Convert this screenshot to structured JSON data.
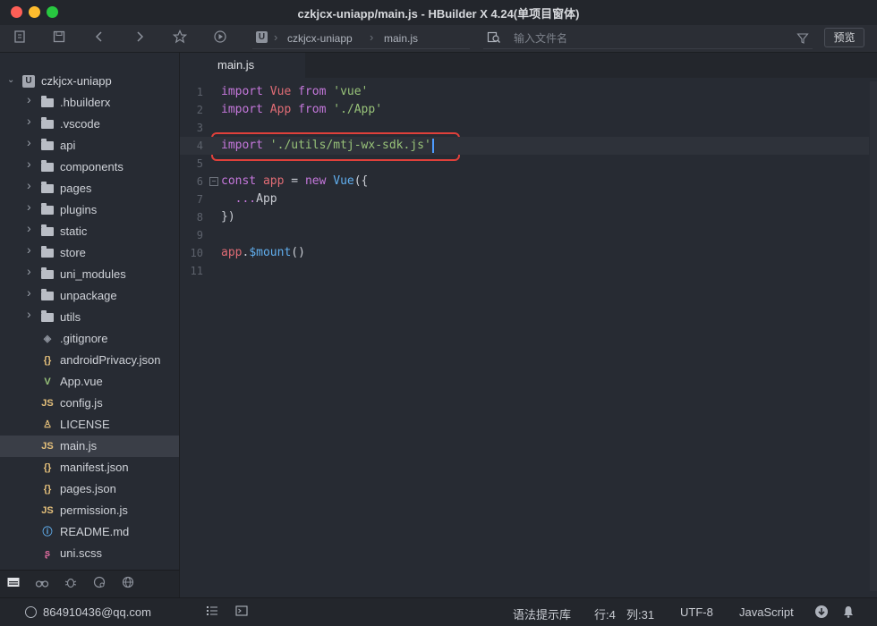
{
  "window": {
    "title": "czkjcx-uniapp/main.js - HBuilder X 4.24(单项目窗体)"
  },
  "toolbar": {
    "breadcrumb": [
      "czkjcx-uniapp",
      "main.js"
    ],
    "search_placeholder": "输入文件名",
    "preview_label": "预览"
  },
  "sidebar": {
    "project": "czkjcx-uniapp",
    "items": [
      {
        "label": ".hbuilderx",
        "type": "folder"
      },
      {
        "label": ".vscode",
        "type": "folder"
      },
      {
        "label": "api",
        "type": "folder"
      },
      {
        "label": "components",
        "type": "folder"
      },
      {
        "label": "pages",
        "type": "folder"
      },
      {
        "label": "plugins",
        "type": "folder"
      },
      {
        "label": "static",
        "type": "folder"
      },
      {
        "label": "store",
        "type": "folder"
      },
      {
        "label": "uni_modules",
        "type": "folder"
      },
      {
        "label": "unpackage",
        "type": "folder"
      },
      {
        "label": "utils",
        "type": "folder"
      },
      {
        "label": ".gitignore",
        "type": "gitignore",
        "glyph": "◈"
      },
      {
        "label": "androidPrivacy.json",
        "type": "json",
        "glyph": "{}"
      },
      {
        "label": "App.vue",
        "type": "vue",
        "glyph": "V"
      },
      {
        "label": "config.js",
        "type": "js",
        "glyph": "JS"
      },
      {
        "label": "LICENSE",
        "type": "license",
        "glyph": "♙"
      },
      {
        "label": "main.js",
        "type": "js",
        "glyph": "JS",
        "selected": true
      },
      {
        "label": "manifest.json",
        "type": "json",
        "glyph": "{}"
      },
      {
        "label": "pages.json",
        "type": "json",
        "glyph": "{}"
      },
      {
        "label": "permission.js",
        "type": "js",
        "glyph": "JS"
      },
      {
        "label": "README.md",
        "type": "md",
        "glyph": "ⓘ"
      },
      {
        "label": "uni.scss",
        "type": "scss",
        "glyph": "ʂ"
      }
    ]
  },
  "editor": {
    "tab": "main.js",
    "lines": [
      {
        "n": "1",
        "tokens": [
          [
            "kw",
            "import "
          ],
          [
            "cls",
            "Vue "
          ],
          [
            "kw",
            "from "
          ],
          [
            "str",
            "'vue'"
          ]
        ]
      },
      {
        "n": "2",
        "tokens": [
          [
            "kw",
            "import "
          ],
          [
            "cls",
            "App "
          ],
          [
            "kw",
            "from "
          ],
          [
            "str",
            "'./App'"
          ]
        ]
      },
      {
        "n": "3",
        "tokens": []
      },
      {
        "n": "4",
        "tokens": [
          [
            "kw",
            "import "
          ],
          [
            "str",
            "'./utils/mtj-wx-sdk.js'"
          ]
        ],
        "current": true
      },
      {
        "n": "5",
        "tokens": []
      },
      {
        "n": "6",
        "tokens": [
          [
            "kw",
            "const "
          ],
          [
            "cls",
            "app "
          ],
          [
            "plain",
            "= "
          ],
          [
            "kw",
            "new "
          ],
          [
            "fn",
            "Vue"
          ],
          [
            "plain",
            "({"
          ]
        ],
        "fold": true
      },
      {
        "n": "7",
        "tokens": [
          [
            "plain",
            "  "
          ],
          [
            "kw",
            "..."
          ],
          [
            "plain",
            "App"
          ]
        ]
      },
      {
        "n": "8",
        "tokens": [
          [
            "plain",
            "})"
          ]
        ]
      },
      {
        "n": "9",
        "tokens": []
      },
      {
        "n": "10",
        "tokens": [
          [
            "cls",
            "app"
          ],
          [
            "plain",
            "."
          ],
          [
            "fn",
            "$mount"
          ],
          [
            "plain",
            "()"
          ]
        ]
      },
      {
        "n": "11",
        "tokens": []
      }
    ]
  },
  "status": {
    "user": "864910436@qq.com",
    "syntax_lib": "语法提示库",
    "row": "行:4",
    "col": "列:31",
    "encoding": "UTF-8",
    "language": "JavaScript"
  },
  "colors": {
    "keyword": "#c678dd",
    "class": "#e06c75",
    "string": "#98c379",
    "function": "#61afef",
    "highlight": "#e0403a",
    "js_icon": "#e5c07b",
    "vue_icon": "#98c379",
    "json_icon": "#e5c07b",
    "md_icon": "#61afef",
    "scss_icon": "#e06c9f"
  }
}
